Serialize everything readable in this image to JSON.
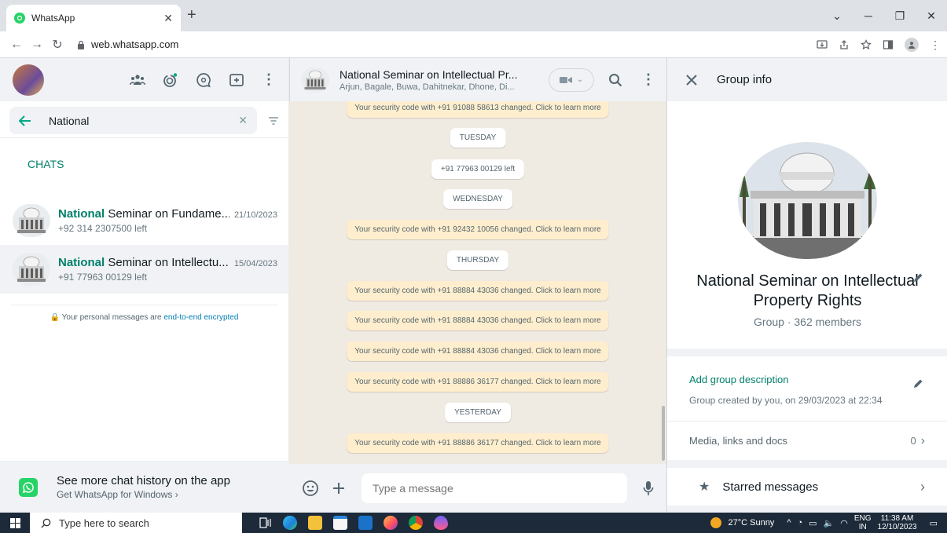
{
  "browser": {
    "tab_title": "WhatsApp",
    "new_tab": "+",
    "url": "web.whatsapp.com"
  },
  "left": {
    "search_value": "National",
    "chats_label": "CHATS",
    "chats": [
      {
        "name_bold": "National",
        "name_rest": " Seminar on Fundame...",
        "date": "21/10/2023",
        "sub": "+92 314 2307500 left"
      },
      {
        "name_bold": "National",
        "name_rest": " Seminar on Intellectu...",
        "date": "15/04/2023",
        "sub": "+91 77963 00129 left"
      }
    ],
    "encryption_text": "Your personal messages are ",
    "encryption_link": "end-to-end encrypted",
    "promo_title": "See more chat history on the app",
    "promo_sub": "Get WhatsApp for Windows ›"
  },
  "chat": {
    "title": "National Seminar on Intellectual Pr...",
    "members": "Arjun, Bagale, Buwa, Dahitnekar, Dhone, Di...",
    "messages": [
      {
        "kind": "sys",
        "text": "Your security code with +91 91088 58613 changed. Click to learn more"
      },
      {
        "kind": "pill",
        "text": "TUESDAY"
      },
      {
        "kind": "pill",
        "text": "+91 77963 00129 left"
      },
      {
        "kind": "pill",
        "text": "WEDNESDAY"
      },
      {
        "kind": "sys",
        "text": "Your security code with +91 92432 10056 changed. Click to learn more"
      },
      {
        "kind": "pill",
        "text": "THURSDAY"
      },
      {
        "kind": "sys",
        "text": "Your security code with +91 88884 43036 changed. Click to learn more"
      },
      {
        "kind": "sys",
        "text": "Your security code with +91 88884 43036 changed. Click to learn more"
      },
      {
        "kind": "sys",
        "text": "Your security code with +91 88884 43036 changed. Click to learn more"
      },
      {
        "kind": "sys",
        "text": "Your security code with +91 88886 36177 changed. Click to learn more"
      },
      {
        "kind": "pill",
        "text": "YESTERDAY"
      },
      {
        "kind": "sys",
        "text": "Your security code with +91 88886 36177 changed. Click to learn more"
      }
    ],
    "composer_placeholder": "Type a message"
  },
  "info": {
    "header": "Group info",
    "group_name": "National Seminar on Intellectual Property Rights",
    "group_meta": "Group · 362 members",
    "add_description": "Add group description",
    "created": "Group created by you, on 29/03/2023 at 22:34",
    "media_label": "Media, links and docs",
    "media_count": "0",
    "starred_label": "Starred messages"
  },
  "taskbar": {
    "search_placeholder": "Type here to search",
    "weather": "27°C  Sunny",
    "lang": "ENG",
    "region": "IN",
    "time": "11:38 AM",
    "date": "12/10/2023"
  },
  "colors": {
    "accent": "#008069",
    "system_bubble": "#ffeecd",
    "chat_bg": "#efeae2"
  }
}
